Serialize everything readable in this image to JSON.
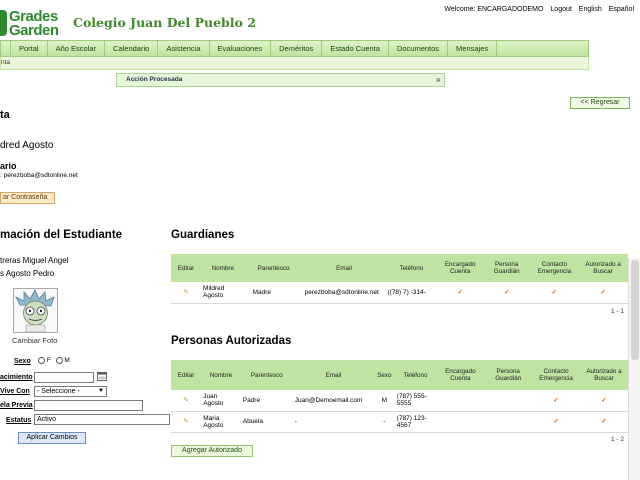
{
  "brand": {
    "logo_line1": "Grades",
    "logo_line2": "Garden",
    "school_name": "Colegio Juan Del Pueblo 2",
    "accent": "#2f8a2f"
  },
  "topbar": {
    "welcome": "Welcome: ENCARGADODEMO",
    "logout": "Logout",
    "lang_en": "English",
    "lang_es": "Español"
  },
  "nav": {
    "items": [
      "Portal",
      "Año Escolar",
      "Calendario",
      "Asistencia",
      "Evaluaciones",
      "Deméritos",
      "Estado Cuenta",
      "Documentos",
      "Mensajes"
    ],
    "sub": "nta"
  },
  "alert": {
    "text": "Acción Procesada",
    "close": "×"
  },
  "back_button": "<< Regresar",
  "account": {
    "title": "ta",
    "name": "dred Agosto",
    "usuario_label": "ario",
    "email_line": "perezboba@sdtonline.net",
    "email_prefix": ":",
    "change_password": "ar Contraseña"
  },
  "student": {
    "title": "mación del Estudiante",
    "line1": "treras Miguel Angel",
    "line2": "s Agosto Pedro",
    "change_photo": "Cambiar Foto",
    "sexo_label": "Sexo",
    "sexo_f": "F",
    "sexo_m": "M",
    "nacimiento_label": "acimiento",
    "vive_con_label": "Vive Con",
    "vive_con_value": "- Seleccione -",
    "escuela_label": "ela Previa",
    "estatus_label": "Estatus",
    "estatus_value": "Activo",
    "apply": "Aplicar Cambios"
  },
  "guardians": {
    "title": "Guardianes",
    "headers": [
      "Editar",
      "Nombre",
      "Parentesco",
      "Email",
      "Teléfono",
      "Encargado Cuenta",
      "Persona Guardián",
      "Contacto Emergencia",
      "Autorizado a Buscar"
    ],
    "rows": [
      {
        "nombre": "Mildred Agosto",
        "parentesco": "Madre",
        "email": "perezboba@sdtonline.net",
        "telefono": "((78) 7) -314-",
        "encargado": true,
        "guardian": true,
        "emergencia": true,
        "autorizado": true
      }
    ],
    "pager": "1 - 1"
  },
  "authorized": {
    "title": "Personas Autorizadas",
    "headers": [
      "Editar",
      "Nombre",
      "Parentesco",
      "Email",
      "Sexo",
      "Teléfono",
      "Encargado Cuenta",
      "Persona Guardián",
      "Contacto Emergencia",
      "Autorizado a Buscar"
    ],
    "rows": [
      {
        "nombre": "Juan Agosto",
        "parentesco": "Padre",
        "email": "Juan@Demoemail.com",
        "sexo": "M",
        "telefono": "(787) 555-5555",
        "encargado": false,
        "guardian": false,
        "emergencia": true,
        "autorizado": true
      },
      {
        "nombre": "Maria Agosto",
        "parentesco": "Abuela",
        "email": "-",
        "sexo": "-",
        "telefono": "(787) 123-4567",
        "encargado": false,
        "guardian": false,
        "emergencia": true,
        "autorizado": true
      }
    ],
    "pager": "1 - 2",
    "add_button": "Agregar Autorizado"
  },
  "icons": {
    "check": "✓",
    "edit": "✎",
    "calendar": "calendar-icon"
  },
  "colors": {
    "nav_bg": "#bfe39e",
    "table_header": "#bfe3a1",
    "check": "#e65a00"
  }
}
